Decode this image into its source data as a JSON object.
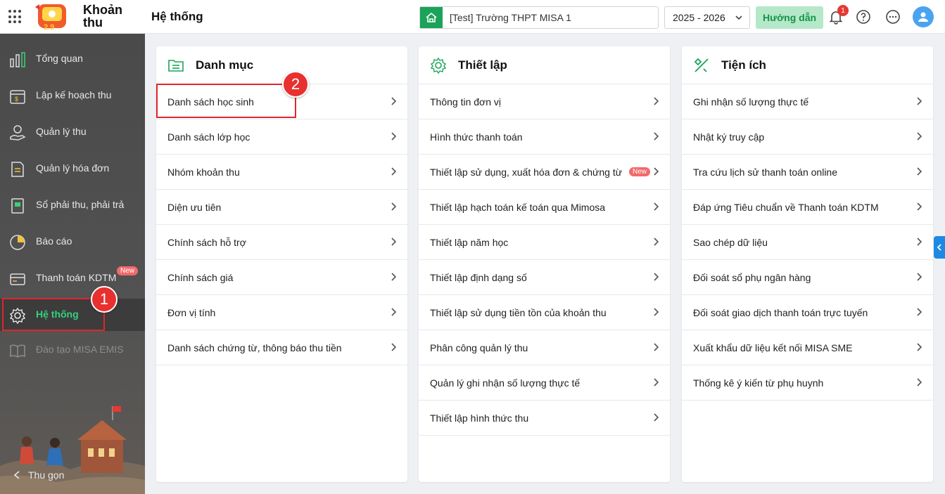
{
  "header": {
    "app_name_line1": "Khoản",
    "app_name_line2": "thu",
    "page_title": "Hệ thống",
    "school": "[Test] Trường THPT MISA 1",
    "school_year": "2025 - 2026",
    "guide_label": "Hướng dẫn",
    "notification_count": "1"
  },
  "sidebar": {
    "items": [
      {
        "label": "Tổng quan",
        "icon": "chart-bars-icon"
      },
      {
        "label": "Lập kế hoạch thu",
        "icon": "calendar-dollar-icon"
      },
      {
        "label": "Quản lý thu",
        "icon": "money-hand-icon"
      },
      {
        "label": "Quản lý hóa đơn",
        "icon": "invoice-icon"
      },
      {
        "label": "Sổ phải thu, phải trả",
        "icon": "ledger-book-icon"
      },
      {
        "label": "Báo cáo",
        "icon": "pie-chart-icon"
      },
      {
        "label": "Thanh toán KDTM",
        "icon": "card-payment-icon",
        "badge": "New"
      },
      {
        "label": "Hệ thống",
        "icon": "gear-icon",
        "active": true
      },
      {
        "label": "Đào tạo MISA EMIS",
        "icon": "open-book-icon"
      }
    ],
    "collapse_label": "Thu gọn"
  },
  "annotations": {
    "step1": "1",
    "step2": "2"
  },
  "cards": [
    {
      "title": "Danh mục",
      "icon": "folder-list-icon",
      "items": [
        "Danh sách học sinh",
        "Danh sách lớp học",
        "Nhóm khoản thu",
        "Diện ưu tiên",
        "Chính sách hỗ trợ",
        "Chính sách giá",
        "Đơn vị tính",
        "Danh sách chứng từ, thông báo thu tiền"
      ]
    },
    {
      "title": "Thiết lập",
      "icon": "settings-icon",
      "items": [
        "Thông tin đơn vị",
        "Hình thức thanh toán",
        "Thiết lập sử dụng, xuất hóa đơn & chứng từ",
        "Thiết lập hạch toán kế toán qua Mimosa",
        "Thiết lập năm học",
        "Thiết lập định dạng số",
        "Thiết lập sử dụng tiền tồn của khoản thu",
        "Phân công quản lý thu",
        "Quản lý ghi nhận số lượng thực tế",
        "Thiết lập hình thức thu"
      ],
      "new_badge": "New"
    },
    {
      "title": "Tiện ích",
      "icon": "tools-icon",
      "items": [
        "Ghi nhận số lượng thực tế",
        "Nhật ký truy cập",
        "Tra cứu lịch sử thanh toán online",
        "Đáp ứng Tiêu chuẩn về Thanh toán KDTM",
        "Sao chép dữ liệu",
        "Đối soát sổ phụ ngân hàng",
        "Đối soát giao dịch thanh toán trực tuyến",
        "Xuất khẩu dữ liệu kết nối MISA SME",
        "Thống kê ý kiến từ phụ huynh"
      ]
    }
  ],
  "colors": {
    "brand_green": "#1ba35a",
    "sidebar_bg": "#4a4a4a",
    "active_green": "#35d07f",
    "highlight_red": "#e0262a"
  }
}
